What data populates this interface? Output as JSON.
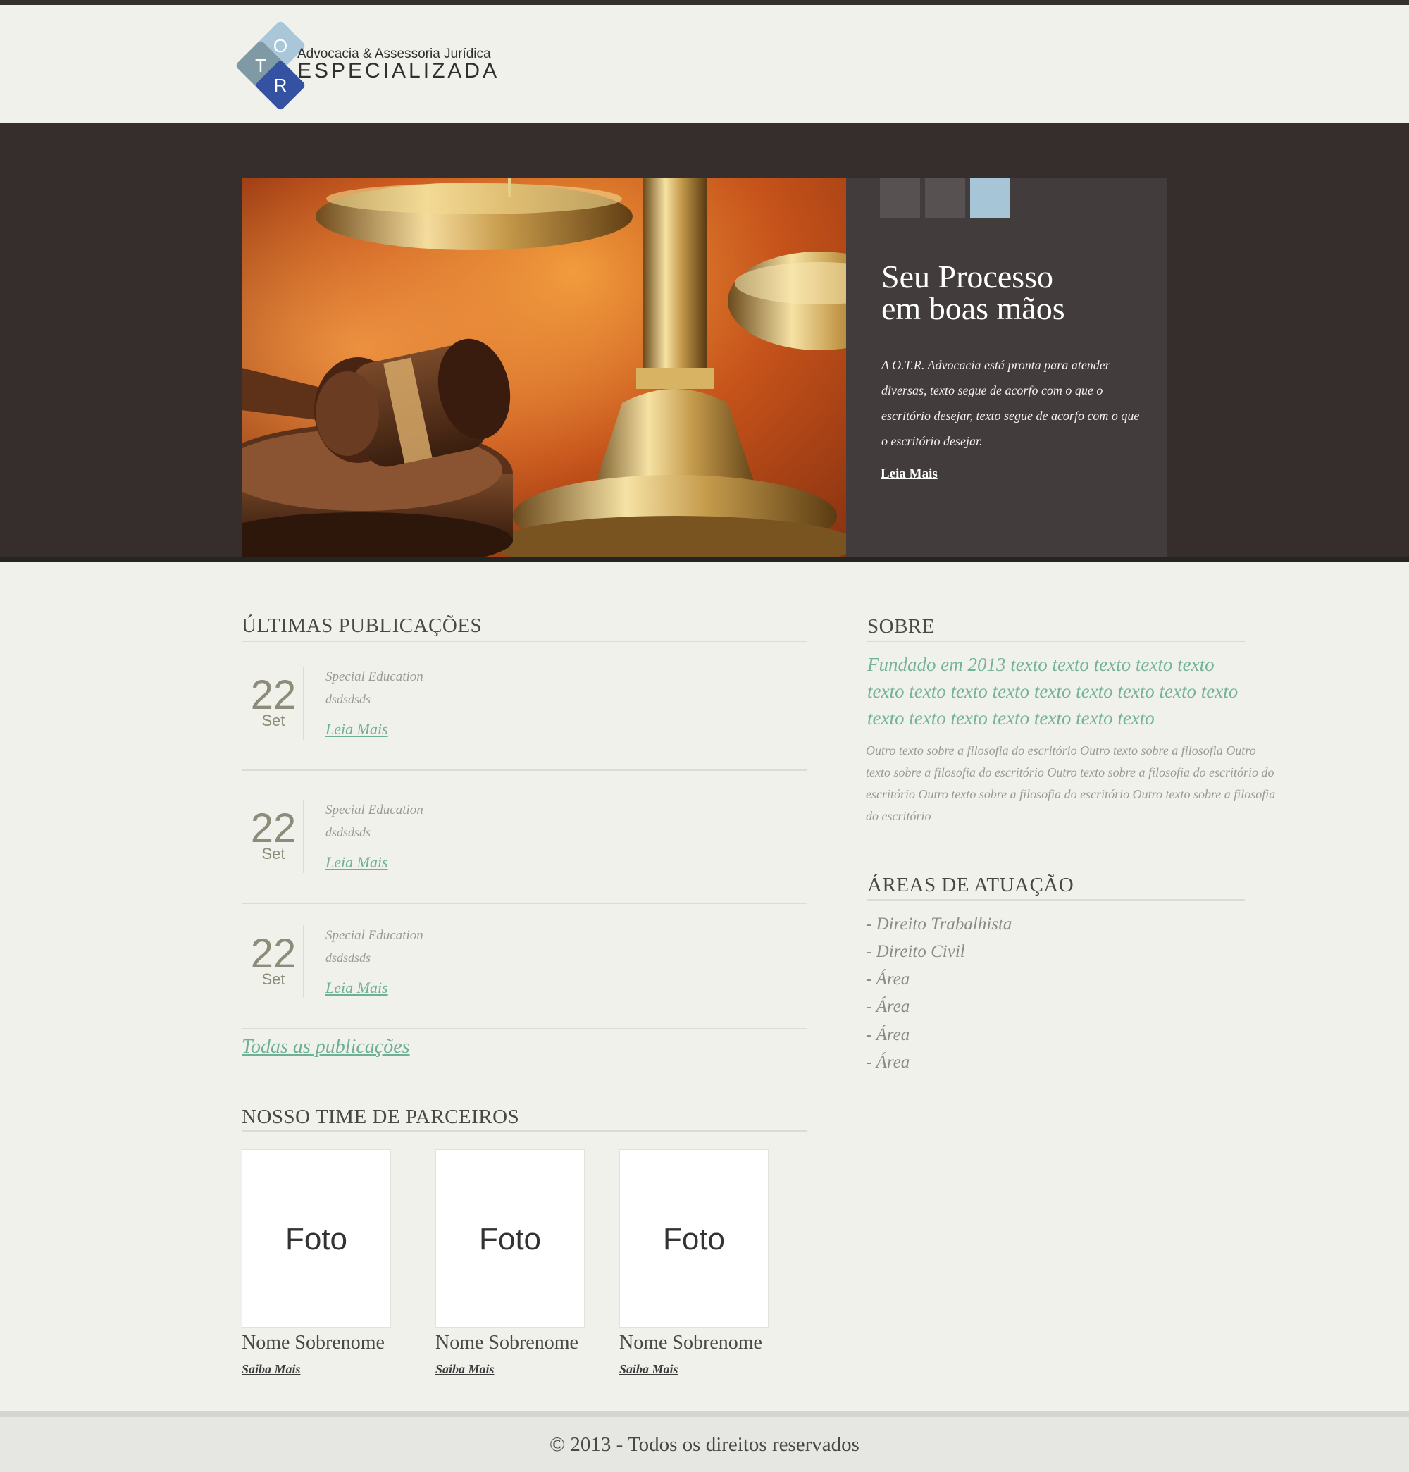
{
  "brand": {
    "logo_letters": [
      "O",
      "T",
      "R"
    ],
    "tagline": "Advocacia & Assessoria Jurídica",
    "name": "ESPECIALIZADA",
    "colors": {
      "diamond_top": "#a9c7d9",
      "diamond_left": "#7f9aa4",
      "diamond_bottom": "#3552a2"
    }
  },
  "hero": {
    "title": "Seu Processo\nem boas mãos",
    "text": "A O.T.R. Advocacia está pronta para atender diversas, texto segue de acorfo com o que o escritório desejar, texto segue de acorfo com o que o escritório desejar.",
    "link": "Leia Mais",
    "slider_active_index": 3,
    "image_description": "gavel-and-scales-of-justice"
  },
  "posts": {
    "heading": "ÚLTIMAS PUBLICAÇÕES",
    "items": [
      {
        "day": "22",
        "month": "Set",
        "category": "Special Education",
        "subtitle": "dsdsdsds",
        "link": "Leia Mais"
      },
      {
        "day": "22",
        "month": "Set",
        "category": "Special Education",
        "subtitle": "dsdsdsds",
        "link": "Leia Mais"
      },
      {
        "day": "22",
        "month": "Set",
        "category": "Special Education",
        "subtitle": "dsdsdsds",
        "link": "Leia Mais"
      }
    ],
    "all_link": "Todas as publicações"
  },
  "partners": {
    "heading": "NOSSO TIME DE PARCEIROS",
    "items": [
      {
        "photo": "Foto",
        "name": "Nome Sobrenome",
        "link": "Saiba Mais"
      },
      {
        "photo": "Foto",
        "name": "Nome Sobrenome",
        "link": "Saiba Mais"
      },
      {
        "photo": "Foto",
        "name": "Nome Sobrenome",
        "link": "Saiba Mais"
      }
    ]
  },
  "about": {
    "heading": "SOBRE",
    "lead": "Fundado em 2013 texto texto texto texto texto texto texto texto texto texto texto texto texto texto texto texto texto texto texto texto texto",
    "text": "Outro texto sobre a filosofia do escritório Outro texto sobre a filosofia Outro texto sobre a filosofia do escritório Outro texto sobre a filosofia do escritório do escritório Outro texto sobre a filosofia do escritório Outro texto sobre a filosofia do escritório"
  },
  "areas": {
    "heading": "ÁREAS DE ATUAÇÃO",
    "items": [
      "- Direito Trabalhista",
      "- Direito Civil",
      "- Área",
      "- Área",
      "- Área",
      "- Área"
    ]
  },
  "footer": {
    "text": "© 2013 - Todos os direitos reservados"
  },
  "colors": {
    "accent_green": "#6db096",
    "dark_band": "#362e2c",
    "panel": "#423c3c",
    "slider_active": "#a6c5d6",
    "page_bg": "#f1f1ec"
  }
}
